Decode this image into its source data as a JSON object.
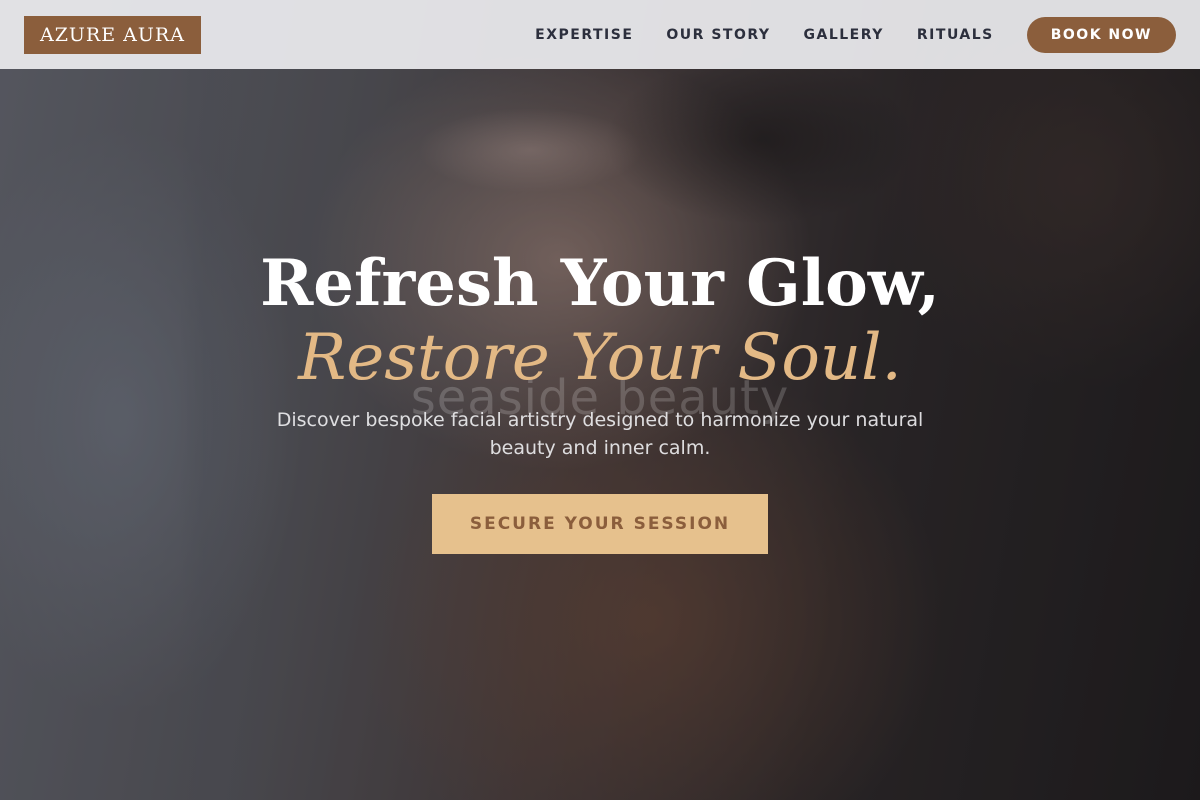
{
  "header": {
    "logo": "AZURE AURA",
    "nav": [
      "EXPERTISE",
      "OUR STORY",
      "GALLERY",
      "RITUALS"
    ],
    "book_button": "BOOK NOW"
  },
  "hero": {
    "watermark": "seaside beauty",
    "title_line1": "Refresh Your Glow,",
    "title_line2": "Restore Your Soul.",
    "subtitle": "Discover bespoke facial artistry designed to harmonize your natural beauty and inner calm.",
    "cta": "SECURE YOUR SESSION"
  },
  "colors": {
    "brand_brown": "#8b5e3c",
    "accent_gold": "#e3b985",
    "cta_background": "#e6c18d",
    "nav_text": "#2c2f3d"
  }
}
